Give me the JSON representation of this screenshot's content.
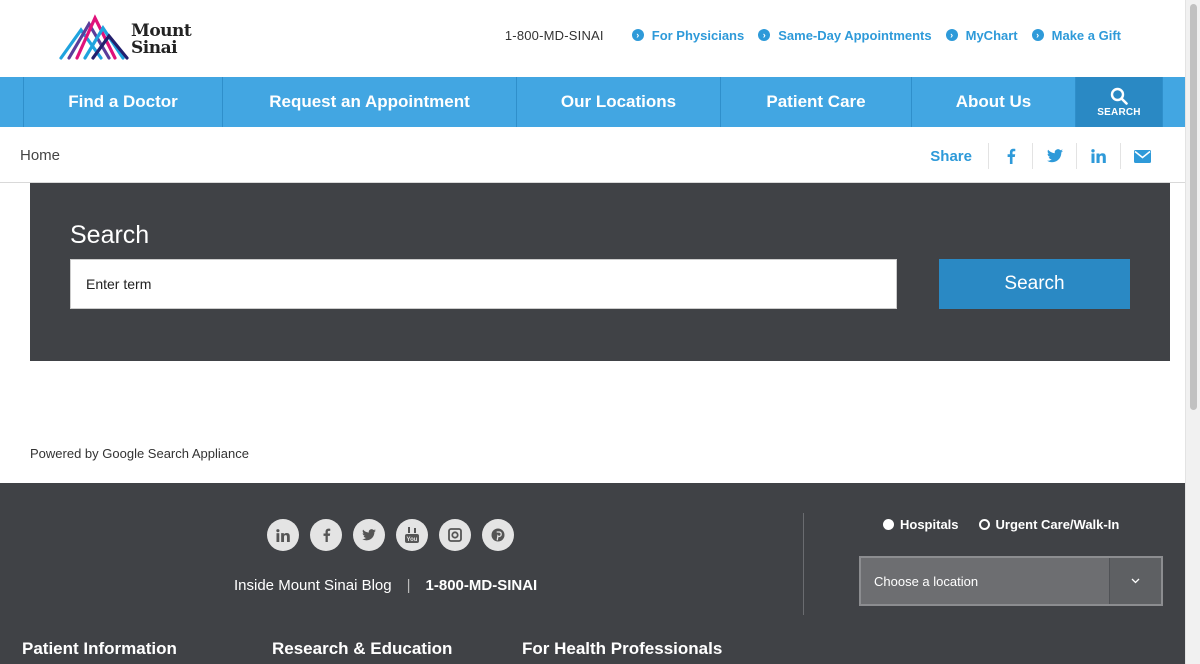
{
  "header": {
    "logo_text_line1": "Mount",
    "logo_text_line2": "Sinai",
    "phone": "1-800-MD-SINAI",
    "links": [
      "For Physicians",
      "Same-Day Appointments",
      "MyChart",
      "Make a Gift"
    ]
  },
  "nav": {
    "items": [
      "Find a Doctor",
      "Request an Appointment",
      "Our Locations",
      "Patient Care",
      "About Us"
    ],
    "search_label": "SEARCH"
  },
  "breadcrumb": {
    "home": "Home"
  },
  "share": {
    "label": "Share",
    "icons": [
      "facebook-icon",
      "twitter-icon",
      "linkedin-icon",
      "email-icon"
    ]
  },
  "search": {
    "title": "Search",
    "placeholder": "Enter term",
    "button_label": "Search"
  },
  "powered_by": "Powered by Google Search Appliance",
  "footer": {
    "social_icons": [
      "linkedin-icon",
      "facebook-icon",
      "twitter-icon",
      "youtube-icon",
      "instagram-icon",
      "pinterest-icon"
    ],
    "blog_link": "Inside Mount Sinai Blog",
    "separator": "|",
    "phone": "1-800-MD-SINAI",
    "radio_options": [
      "Hospitals",
      "Urgent Care/Walk-In"
    ],
    "radio_selected": "Hospitals",
    "location_select": "Choose a location",
    "columns": [
      "Patient Information",
      "Research & Education",
      "For Health Professionals"
    ]
  },
  "colors": {
    "brand_blue": "#42a6e2",
    "link_blue": "#2e9ad9",
    "button_blue": "#2a89c4",
    "dark_panel": "#404246"
  }
}
